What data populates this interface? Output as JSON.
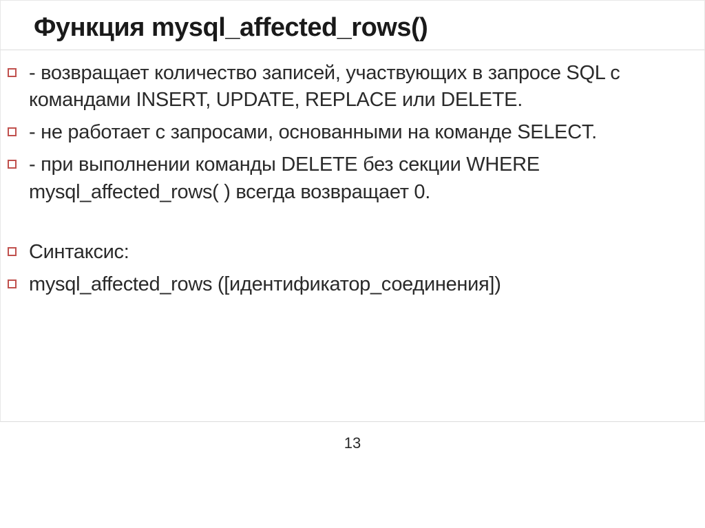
{
  "slide": {
    "title": "Функция mysql_affected_rows()",
    "bullets": [
      "- возвращает количество записей, участвующих в запросе SQL с командами INSERT, UPDATE, REPLACE или DELETE.",
      "- не работает с запросами, основанными на команде SELECT.",
      "- при выполнении команды DELETE без секции WHERE mysql_affected_rows( ) всегда возвращает 0.",
      "Синтаксис:",
      "mysql_affected_rows ([идентификатор_соединения])"
    ],
    "page_number": "13"
  }
}
